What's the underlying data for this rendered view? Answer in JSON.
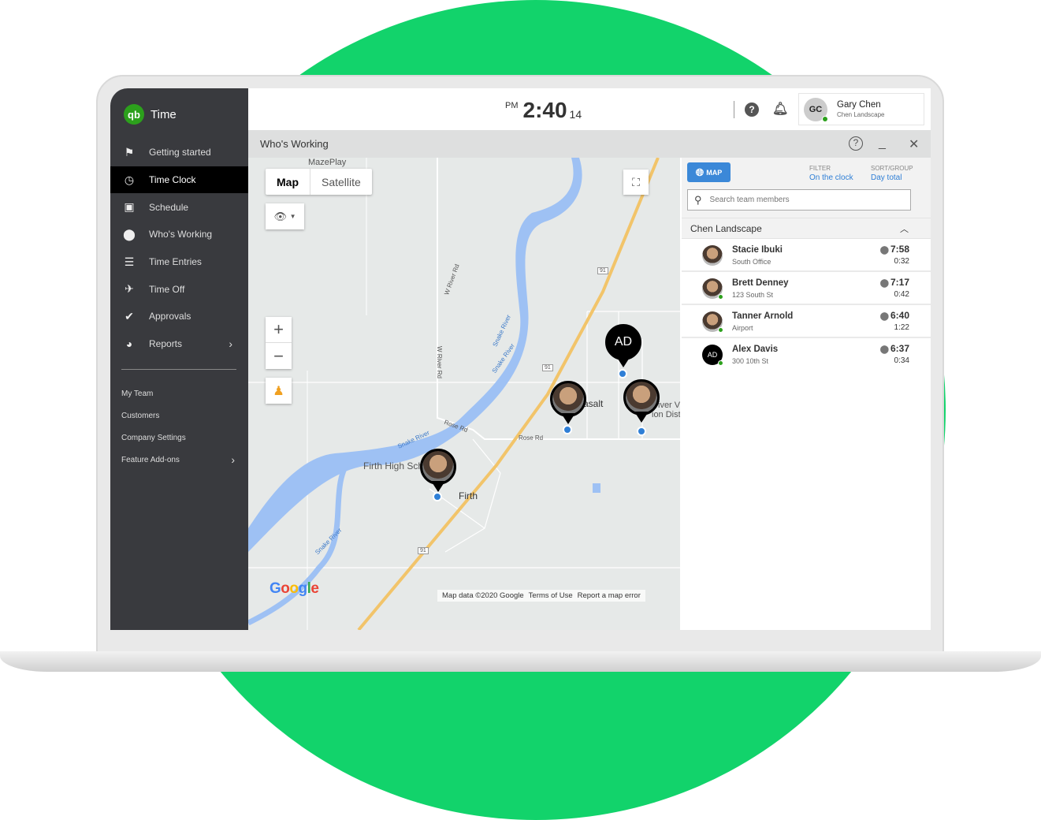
{
  "app": {
    "logo_text": "qb",
    "title": "Time",
    "brand_color": "#2ca01c",
    "accent_color": "#12d36b"
  },
  "sidebar": {
    "items": [
      {
        "label": "Getting started",
        "icon": "flag-icon"
      },
      {
        "label": "Time Clock",
        "icon": "clock-icon",
        "active": true
      },
      {
        "label": "Schedule",
        "icon": "calendar-icon"
      },
      {
        "label": "Who's Working",
        "icon": "map-pin-icon"
      },
      {
        "label": "Time Entries",
        "icon": "list-clock-icon"
      },
      {
        "label": "Time Off",
        "icon": "airplane-icon"
      },
      {
        "label": "Approvals",
        "icon": "double-check-icon"
      },
      {
        "label": "Reports",
        "icon": "pie-chart-icon",
        "has_submenu": true
      }
    ],
    "secondary": [
      {
        "label": "My Team"
      },
      {
        "label": "Customers"
      },
      {
        "label": "Company Settings"
      },
      {
        "label": "Feature Add-ons",
        "has_submenu": true
      }
    ]
  },
  "header": {
    "clock": {
      "ampm": "PM",
      "time": "2:40",
      "seconds": "14"
    },
    "user": {
      "initials": "GC",
      "name": "Gary Chen",
      "company": "Chen Landscape"
    }
  },
  "panel": {
    "title": "Who's Working"
  },
  "map": {
    "type_options": [
      "Map",
      "Satellite"
    ],
    "selected_type": "Map",
    "labels": {
      "mazeplay": "MazePlay",
      "w_river_rd": "W River Rd",
      "w_river_rd2": "W River Rd",
      "snake_river1": "Snake River",
      "snake_river2": "Snake River",
      "snake_river3": "Snake River",
      "snake_river4": "Snake River",
      "rose_rd1": "Rose Rd",
      "rose_rd2": "Rose Rd",
      "firth": "Firth",
      "firth_high": "Firth High Sch",
      "basalt": "asalt",
      "river_v": "iver V",
      "tion_dist": "ion Dist",
      "hwy1": "91",
      "hwy2": "91",
      "hwy3": "91"
    },
    "pins": [
      {
        "initials": "AD"
      }
    ],
    "google": "Google",
    "attribution": [
      "Map data ©2020 Google",
      "Terms of Use",
      "Report a map error"
    ]
  },
  "team_panel": {
    "map_button": "MAP",
    "filter_label": "FILTER",
    "filter_value": "On the clock",
    "sort_label": "SORT/GROUP",
    "sort_value": "Day total",
    "search_placeholder": "Search team members",
    "group": "Chen Landscape",
    "members": [
      {
        "name": "Stacie Ibuki",
        "location": "South Office",
        "clock_in": "7:58",
        "day_total": "0:32",
        "online": false
      },
      {
        "name": "Brett Denney",
        "location": "123 South St",
        "clock_in": "7:17",
        "day_total": "0:42",
        "online": true
      },
      {
        "name": "Tanner Arnold",
        "location": "Airport",
        "clock_in": "6:40",
        "day_total": "1:22",
        "online": true
      },
      {
        "name": "Alex Davis",
        "initials": "AD",
        "location": "300 10th St",
        "clock_in": "6:37",
        "day_total": "0:34",
        "online": true
      }
    ]
  }
}
